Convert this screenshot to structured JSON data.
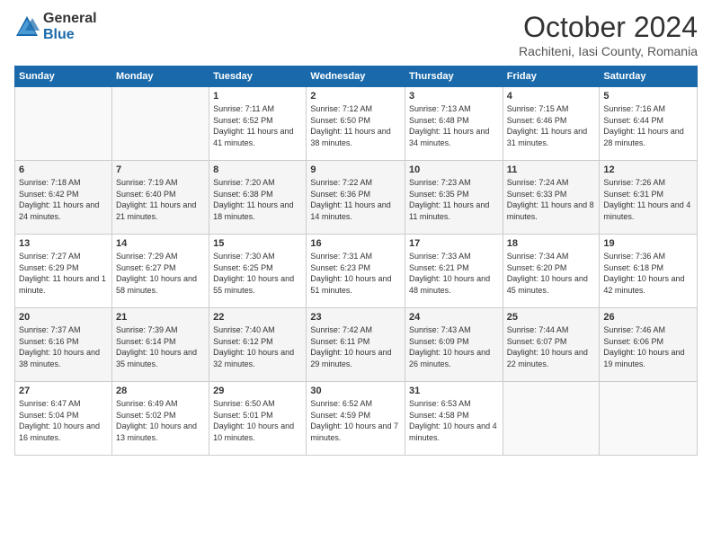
{
  "header": {
    "logo_general": "General",
    "logo_blue": "Blue",
    "month_title": "October 2024",
    "location": "Rachiteni, Iasi County, Romania"
  },
  "weekdays": [
    "Sunday",
    "Monday",
    "Tuesday",
    "Wednesday",
    "Thursday",
    "Friday",
    "Saturday"
  ],
  "weeks": [
    [
      {
        "day": "",
        "info": ""
      },
      {
        "day": "",
        "info": ""
      },
      {
        "day": "1",
        "info": "Sunrise: 7:11 AM\nSunset: 6:52 PM\nDaylight: 11 hours and 41 minutes."
      },
      {
        "day": "2",
        "info": "Sunrise: 7:12 AM\nSunset: 6:50 PM\nDaylight: 11 hours and 38 minutes."
      },
      {
        "day": "3",
        "info": "Sunrise: 7:13 AM\nSunset: 6:48 PM\nDaylight: 11 hours and 34 minutes."
      },
      {
        "day": "4",
        "info": "Sunrise: 7:15 AM\nSunset: 6:46 PM\nDaylight: 11 hours and 31 minutes."
      },
      {
        "day": "5",
        "info": "Sunrise: 7:16 AM\nSunset: 6:44 PM\nDaylight: 11 hours and 28 minutes."
      }
    ],
    [
      {
        "day": "6",
        "info": "Sunrise: 7:18 AM\nSunset: 6:42 PM\nDaylight: 11 hours and 24 minutes."
      },
      {
        "day": "7",
        "info": "Sunrise: 7:19 AM\nSunset: 6:40 PM\nDaylight: 11 hours and 21 minutes."
      },
      {
        "day": "8",
        "info": "Sunrise: 7:20 AM\nSunset: 6:38 PM\nDaylight: 11 hours and 18 minutes."
      },
      {
        "day": "9",
        "info": "Sunrise: 7:22 AM\nSunset: 6:36 PM\nDaylight: 11 hours and 14 minutes."
      },
      {
        "day": "10",
        "info": "Sunrise: 7:23 AM\nSunset: 6:35 PM\nDaylight: 11 hours and 11 minutes."
      },
      {
        "day": "11",
        "info": "Sunrise: 7:24 AM\nSunset: 6:33 PM\nDaylight: 11 hours and 8 minutes."
      },
      {
        "day": "12",
        "info": "Sunrise: 7:26 AM\nSunset: 6:31 PM\nDaylight: 11 hours and 4 minutes."
      }
    ],
    [
      {
        "day": "13",
        "info": "Sunrise: 7:27 AM\nSunset: 6:29 PM\nDaylight: 11 hours and 1 minute."
      },
      {
        "day": "14",
        "info": "Sunrise: 7:29 AM\nSunset: 6:27 PM\nDaylight: 10 hours and 58 minutes."
      },
      {
        "day": "15",
        "info": "Sunrise: 7:30 AM\nSunset: 6:25 PM\nDaylight: 10 hours and 55 minutes."
      },
      {
        "day": "16",
        "info": "Sunrise: 7:31 AM\nSunset: 6:23 PM\nDaylight: 10 hours and 51 minutes."
      },
      {
        "day": "17",
        "info": "Sunrise: 7:33 AM\nSunset: 6:21 PM\nDaylight: 10 hours and 48 minutes."
      },
      {
        "day": "18",
        "info": "Sunrise: 7:34 AM\nSunset: 6:20 PM\nDaylight: 10 hours and 45 minutes."
      },
      {
        "day": "19",
        "info": "Sunrise: 7:36 AM\nSunset: 6:18 PM\nDaylight: 10 hours and 42 minutes."
      }
    ],
    [
      {
        "day": "20",
        "info": "Sunrise: 7:37 AM\nSunset: 6:16 PM\nDaylight: 10 hours and 38 minutes."
      },
      {
        "day": "21",
        "info": "Sunrise: 7:39 AM\nSunset: 6:14 PM\nDaylight: 10 hours and 35 minutes."
      },
      {
        "day": "22",
        "info": "Sunrise: 7:40 AM\nSunset: 6:12 PM\nDaylight: 10 hours and 32 minutes."
      },
      {
        "day": "23",
        "info": "Sunrise: 7:42 AM\nSunset: 6:11 PM\nDaylight: 10 hours and 29 minutes."
      },
      {
        "day": "24",
        "info": "Sunrise: 7:43 AM\nSunset: 6:09 PM\nDaylight: 10 hours and 26 minutes."
      },
      {
        "day": "25",
        "info": "Sunrise: 7:44 AM\nSunset: 6:07 PM\nDaylight: 10 hours and 22 minutes."
      },
      {
        "day": "26",
        "info": "Sunrise: 7:46 AM\nSunset: 6:06 PM\nDaylight: 10 hours and 19 minutes."
      }
    ],
    [
      {
        "day": "27",
        "info": "Sunrise: 6:47 AM\nSunset: 5:04 PM\nDaylight: 10 hours and 16 minutes."
      },
      {
        "day": "28",
        "info": "Sunrise: 6:49 AM\nSunset: 5:02 PM\nDaylight: 10 hours and 13 minutes."
      },
      {
        "day": "29",
        "info": "Sunrise: 6:50 AM\nSunset: 5:01 PM\nDaylight: 10 hours and 10 minutes."
      },
      {
        "day": "30",
        "info": "Sunrise: 6:52 AM\nSunset: 4:59 PM\nDaylight: 10 hours and 7 minutes."
      },
      {
        "day": "31",
        "info": "Sunrise: 6:53 AM\nSunset: 4:58 PM\nDaylight: 10 hours and 4 minutes."
      },
      {
        "day": "",
        "info": ""
      },
      {
        "day": "",
        "info": ""
      }
    ]
  ]
}
